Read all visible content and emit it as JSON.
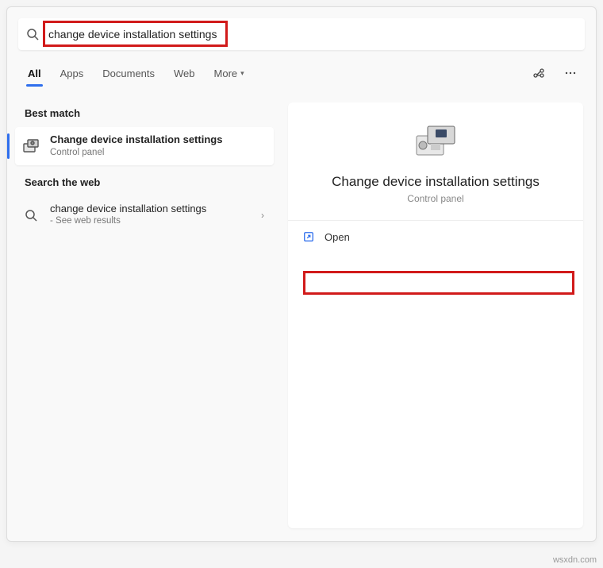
{
  "search": {
    "value": "change device installation settings"
  },
  "tabs": {
    "all": "All",
    "apps": "Apps",
    "documents": "Documents",
    "web": "Web",
    "more": "More"
  },
  "left": {
    "best_match_label": "Best match",
    "best_match": {
      "title": "Change device installation settings",
      "subtitle": "Control panel"
    },
    "search_web_label": "Search the web",
    "web_result": {
      "title": "change device installation settings",
      "subtitle": "- See web results"
    }
  },
  "preview": {
    "title": "Change device installation settings",
    "subtitle": "Control panel",
    "open_label": "Open"
  },
  "watermark": "wsxdn.com"
}
